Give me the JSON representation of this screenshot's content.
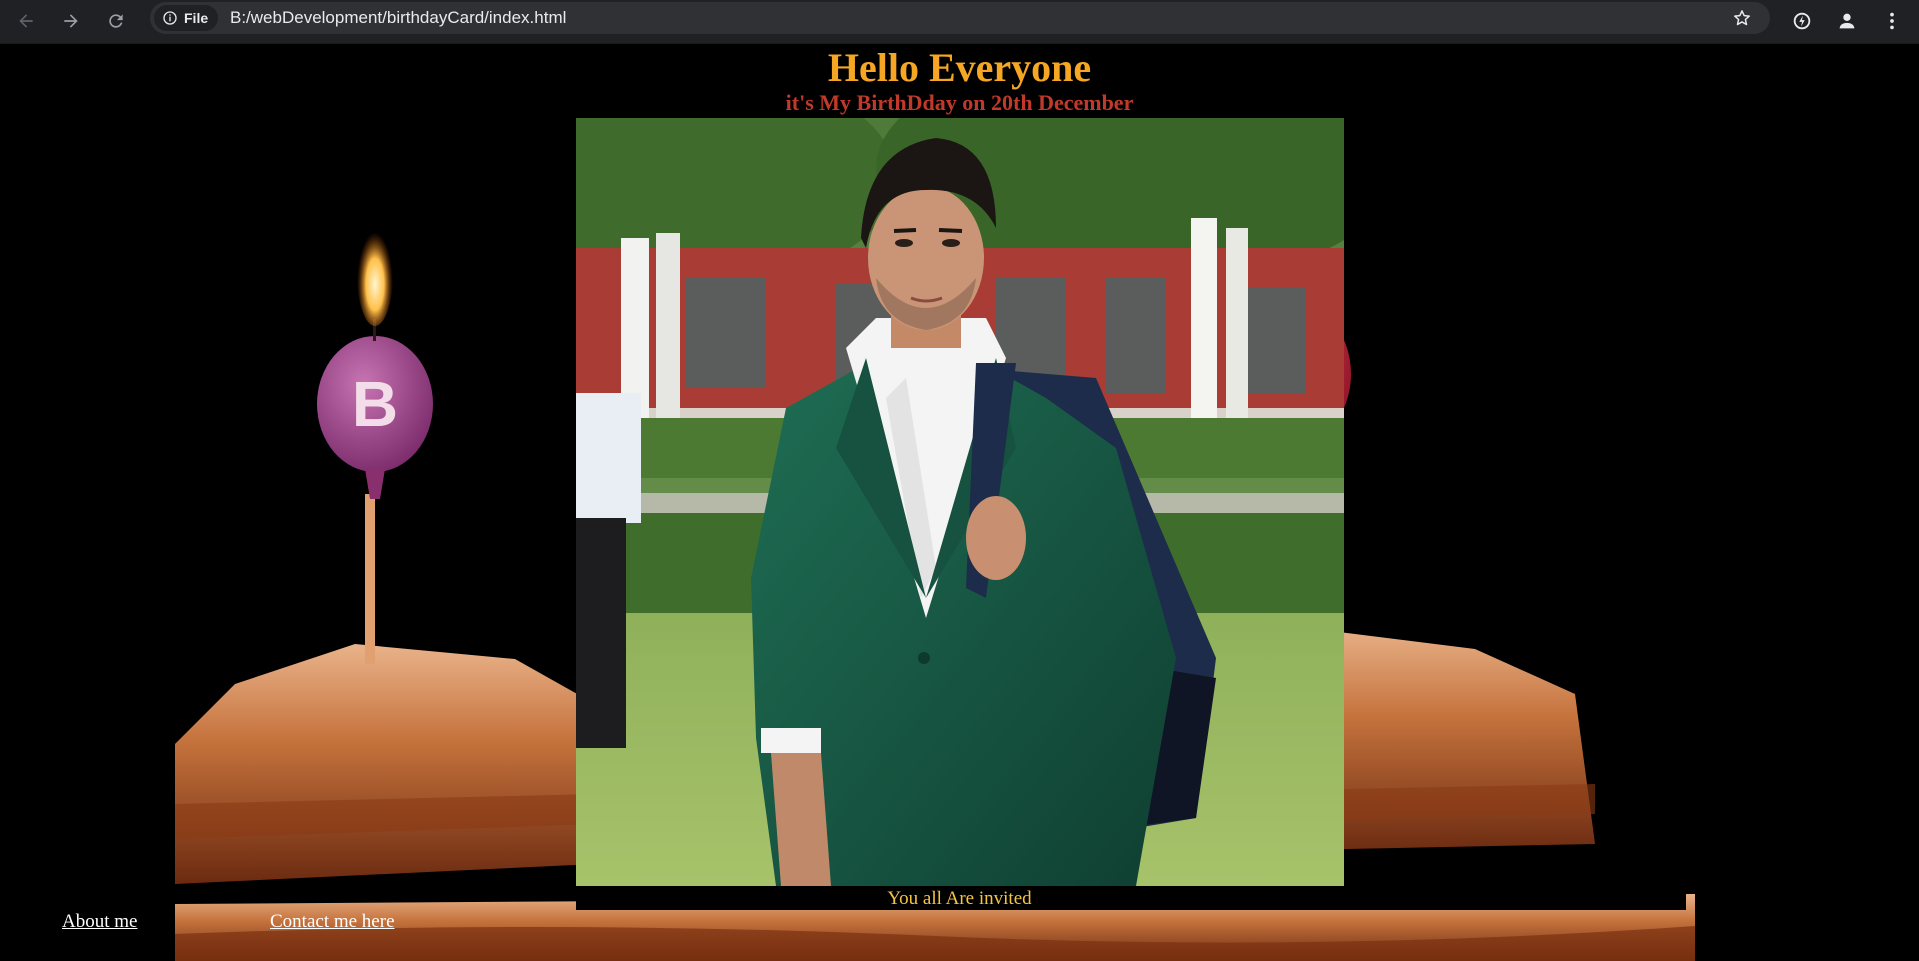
{
  "browser": {
    "address_chip": "File",
    "url": "B:/webDevelopment/birthdayCard/index.html",
    "icons": [
      "back-icon",
      "forward-icon",
      "reload-icon",
      "info-icon",
      "star-icon",
      "extension-icon",
      "profile-icon",
      "menu-icon"
    ]
  },
  "page": {
    "heading": "Hello Everyone",
    "subheading": "it's My BirthDday on 20th December",
    "caption": "You all Are invited",
    "links": {
      "about": "About me",
      "contact": "Contact me here"
    },
    "colors": {
      "heading": "#f5a623",
      "subheading": "#c0392b",
      "caption": "#f5c542",
      "background": "#000000"
    }
  }
}
